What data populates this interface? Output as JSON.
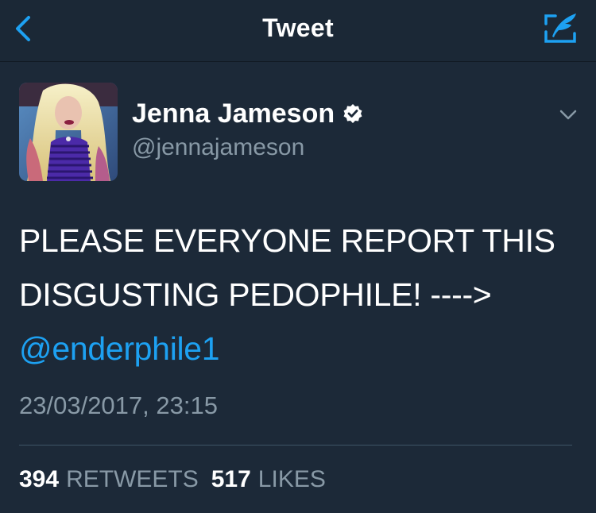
{
  "nav": {
    "title": "Tweet",
    "back_icon": "chevron-left-icon",
    "compose_icon": "compose-tweet-icon",
    "accent_color": "#1da1f2"
  },
  "tweet": {
    "author": {
      "name": "Jenna Jameson",
      "handle": "@jennajameson",
      "verified": true,
      "avatar": "profile-photo"
    },
    "text_lines": [
      "PLEASE EVERYONE REPORT THIS",
      "DISGUSTING PEDOPHILE! ---->"
    ],
    "mention": "@enderphile1",
    "timestamp": "23/03/2017, 23:15",
    "stats": {
      "retweets_count": "394",
      "retweets_label": "RETWEETS",
      "likes_count": "517",
      "likes_label": "LIKES"
    }
  },
  "colors": {
    "background": "#1c2938",
    "secondary_text": "#8899a6",
    "link": "#1da1f2"
  }
}
